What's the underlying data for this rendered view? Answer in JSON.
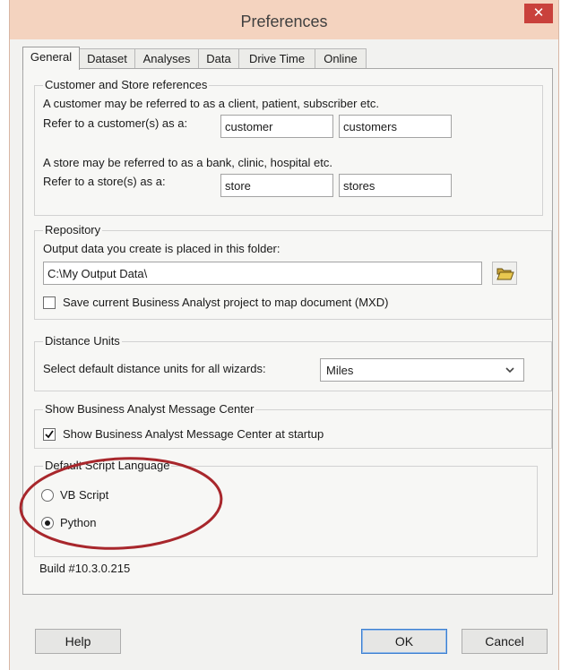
{
  "window": {
    "title": "Preferences",
    "close_glyph": "✕"
  },
  "tabs": [
    {
      "label": "General",
      "active": true
    },
    {
      "label": "Dataset"
    },
    {
      "label": "Analyses"
    },
    {
      "label": "Data"
    },
    {
      "label": "Drive Time"
    },
    {
      "label": "Online"
    }
  ],
  "customer_store": {
    "title": "Customer and Store references",
    "customer_desc": "A customer may be referred to as a client, patient, subscriber etc.",
    "customer_label": "Refer to a customer(s) as a:",
    "customer_singular": "customer",
    "customer_plural": "customers",
    "store_desc": "A store may be referred to as a bank, clinic, hospital etc.",
    "store_label": "Refer to a store(s) as a:",
    "store_singular": "store",
    "store_plural": "stores"
  },
  "repository": {
    "title": "Repository",
    "desc": "Output data you create is placed in this folder:",
    "path": "C:\\My Output Data\\",
    "browse_icon": "folder-open-icon",
    "save_project_label": "Save current Business Analyst project to map document (MXD)",
    "save_project_checked": false
  },
  "distance": {
    "title": "Distance Units",
    "label": "Select default distance units for all wizards:",
    "selected": "Miles"
  },
  "message_center": {
    "title": "Show Business Analyst Message Center",
    "checkbox_label": "Show Business Analyst Message Center at startup",
    "checked": true
  },
  "script_language": {
    "title": "Default Script Language",
    "options": [
      {
        "label": "VB Script",
        "selected": false
      },
      {
        "label": "Python",
        "selected": true
      }
    ]
  },
  "build": "Build #10.3.0.215",
  "buttons": {
    "help": "Help",
    "ok": "OK",
    "cancel": "Cancel"
  },
  "colors": {
    "titlebar": "#f4d3bf",
    "close": "#c9413c",
    "highlight_ellipse": "#a8272c"
  }
}
